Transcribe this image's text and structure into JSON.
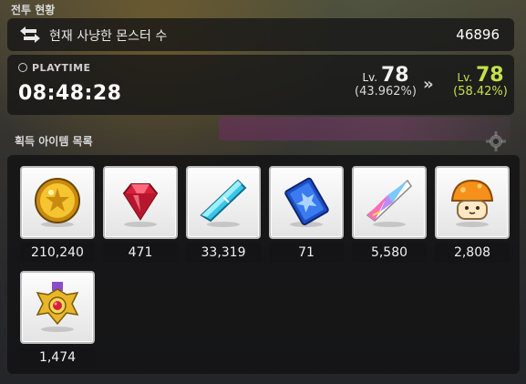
{
  "header": {
    "section_title": "전투 현황"
  },
  "kills": {
    "label": "현재 사냥한 몬스터 수",
    "count": "46896"
  },
  "playtime": {
    "label": "PLAYTIME",
    "time": "08:48:28"
  },
  "level_from": {
    "prefix": "Lv.",
    "level": "78",
    "percent": "(43.962%)"
  },
  "level_to": {
    "prefix": "Lv.",
    "level": "78",
    "percent": "(58.42%)"
  },
  "level_arrow": "»",
  "items": {
    "title": "획득 아이템 목록",
    "list": [
      {
        "icon": "meso-coin-icon",
        "count": "210,240"
      },
      {
        "icon": "red-gem-icon",
        "count": "471"
      },
      {
        "icon": "blue-crystal-icon",
        "count": "33,319"
      },
      {
        "icon": "blue-card-icon",
        "count": "71"
      },
      {
        "icon": "rainbow-crystal-icon",
        "count": "5,580"
      },
      {
        "icon": "orange-mushroom-icon",
        "count": "2,808"
      },
      {
        "icon": "medal-icon",
        "count": "1,474"
      }
    ]
  },
  "colors": {
    "level_up_accent": "#c5e04a",
    "panel_bg": "#141416"
  }
}
